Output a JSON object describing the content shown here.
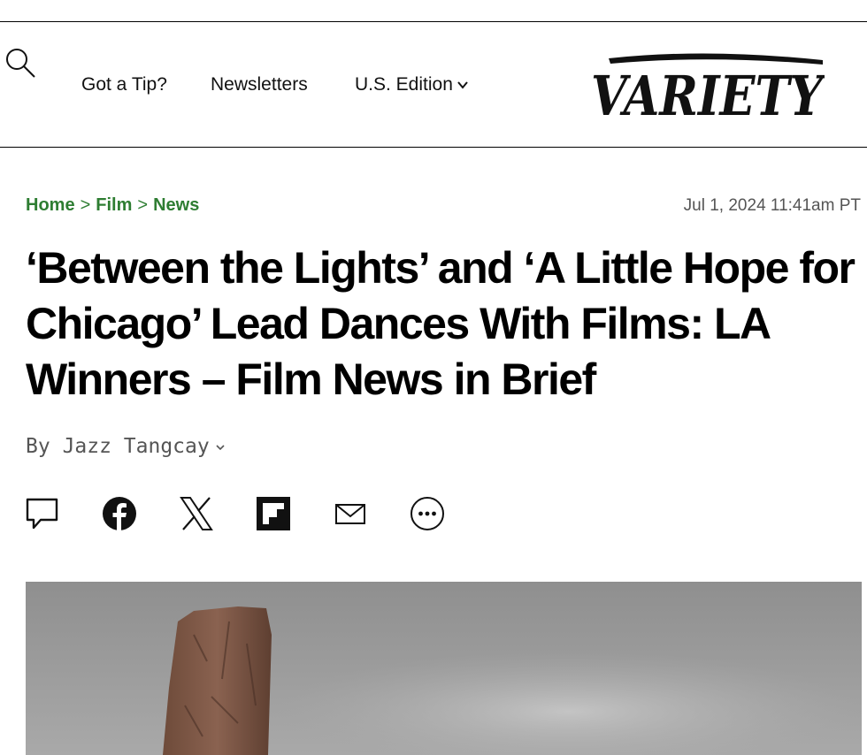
{
  "header": {
    "nav": {
      "tip_label": "Got a Tip?",
      "newsletters_label": "Newsletters",
      "edition_label": "U.S. Edition"
    },
    "logo_text": "VARIETY"
  },
  "article": {
    "breadcrumb": [
      "Home",
      "Film",
      "News"
    ],
    "breadcrumb_separator": ">",
    "timestamp": "Jul 1, 2024 11:41am PT",
    "headline": "‘Between the Lights’ and ‘A Little Hope for Chicago’ Lead Dances With Films: LA Winners – Film News in Brief",
    "byline_prefix": "By",
    "author": "Jazz Tangcay"
  },
  "share_icons": [
    "comment-icon",
    "facebook-icon",
    "x-icon",
    "flipboard-icon",
    "email-icon",
    "more-icon"
  ],
  "colors": {
    "breadcrumb": "#2e7d32",
    "text": "#000000",
    "muted": "#555555"
  }
}
